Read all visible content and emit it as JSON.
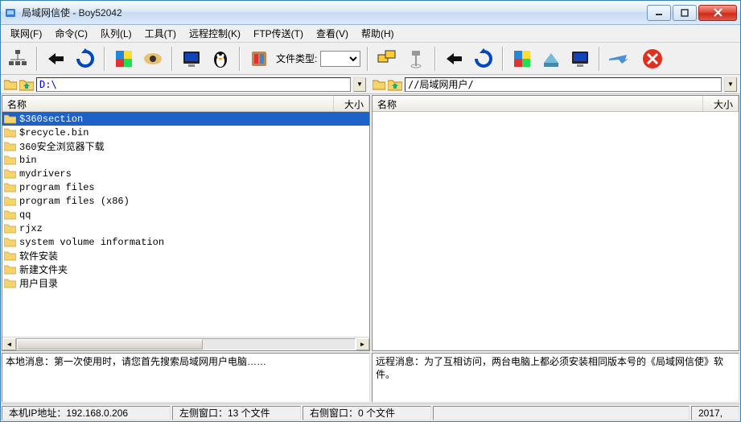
{
  "title": "局域网信使 - Boy52042",
  "menu": [
    "联网(F)",
    "命令(C)",
    "队列(L)",
    "工具(T)",
    "远程控制(K)",
    "FTP传送(T)",
    "查看(V)",
    "帮助(H)"
  ],
  "filetype_label": "文件类型:",
  "left_path": "D:\\",
  "right_path": "//局域网用户/",
  "columns": {
    "name": "名称",
    "size": "大小"
  },
  "left_files": [
    "$360section",
    "$recycle.bin",
    "360安全浏览器下载",
    "bin",
    "mydrivers",
    "program files",
    "program files (x86)",
    "qq",
    "rjxz",
    "system volume information",
    "软件安装",
    "新建文件夹",
    "用户目录"
  ],
  "right_files": [],
  "left_msg": "本地消息：第一次使用时，请您首先搜索局域网用户电脑……",
  "right_msg": "远程消息：为了互相访问，两台电脑上都必须安装相同版本号的《局域网信使》软件。",
  "status": {
    "ip": "本机IP地址：192.168.0.206",
    "left": "左侧窗口：13 个文件",
    "right": "右侧窗口：0 个文件",
    "year": "2017,"
  }
}
